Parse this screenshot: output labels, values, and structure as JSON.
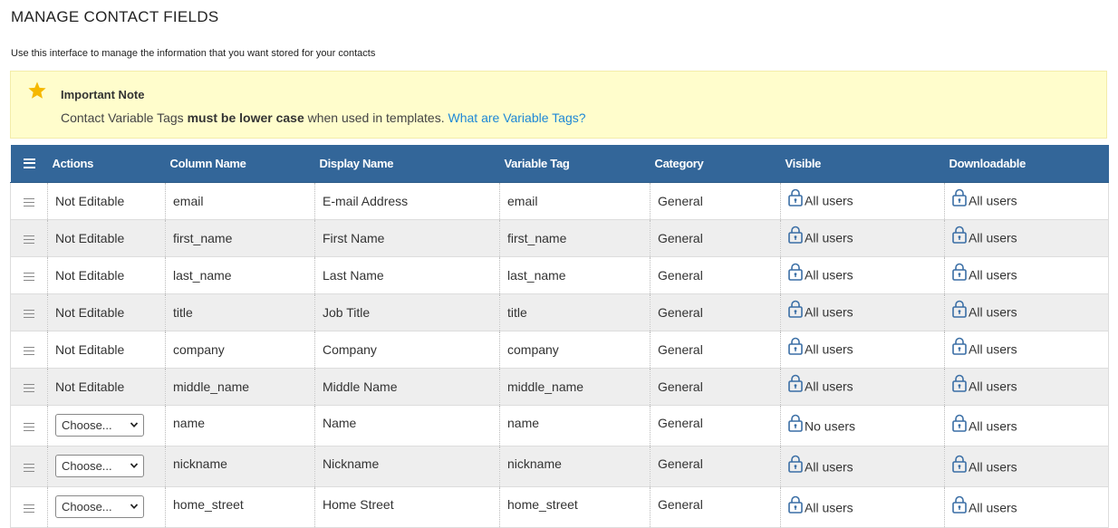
{
  "page": {
    "title": "MANAGE CONTACT FIELDS",
    "subtitle": "Use this interface to manage the information that you want stored for your contacts"
  },
  "note": {
    "icon": "star-icon",
    "title": "Important Note",
    "text_before": "Contact Variable Tags ",
    "text_bold": "must be lower case",
    "text_after": " when used in templates. ",
    "link": "What are Variable Tags?"
  },
  "colors": {
    "header_bg": "#336699",
    "note_bg": "#fffdcc",
    "link": "#1e88d6",
    "star": "#f5b800",
    "lock": "#3a6ea5"
  },
  "table": {
    "headers": {
      "menu_icon": "menu-icon",
      "actions": "Actions",
      "column_name": "Column Name",
      "display_name": "Display Name",
      "variable_tag": "Variable Tag",
      "category": "Category",
      "visible": "Visible",
      "downloadable": "Downloadable"
    },
    "rows": [
      {
        "actions": "Not Editable",
        "column_name": "email",
        "display_name": "E-mail Address",
        "variable_tag": "email",
        "category": "General",
        "visible": "All users",
        "downloadable": "All users"
      },
      {
        "actions": "Not Editable",
        "column_name": "first_name",
        "display_name": "First Name",
        "variable_tag": "first_name",
        "category": "General",
        "visible": "All users",
        "downloadable": "All users"
      },
      {
        "actions": "Not Editable",
        "column_name": "last_name",
        "display_name": "Last Name",
        "variable_tag": "last_name",
        "category": "General",
        "visible": "All users",
        "downloadable": "All users"
      },
      {
        "actions": "Not Editable",
        "column_name": "title",
        "display_name": "Job Title",
        "variable_tag": "title",
        "category": "General",
        "visible": "All users",
        "downloadable": "All users"
      },
      {
        "actions": "Not Editable",
        "column_name": "company",
        "display_name": "Company",
        "variable_tag": "company",
        "category": "General",
        "visible": "All users",
        "downloadable": "All users"
      },
      {
        "actions": "Not Editable",
        "column_name": "middle_name",
        "display_name": "Middle Name",
        "variable_tag": "middle_name",
        "category": "General",
        "visible": "All users",
        "downloadable": "All users"
      },
      {
        "actions": "Choose...",
        "column_name": "name",
        "display_name": "Name",
        "variable_tag": "name",
        "category": "General",
        "visible": "No users",
        "downloadable": "All users"
      },
      {
        "actions": "Choose...",
        "column_name": "nickname",
        "display_name": "Nickname",
        "variable_tag": "nickname",
        "category": "General",
        "visible": "All users",
        "downloadable": "All users"
      },
      {
        "actions": "Choose...",
        "column_name": "home_street",
        "display_name": "Home Street",
        "variable_tag": "home_street",
        "category": "General",
        "visible": "All users",
        "downloadable": "All users"
      }
    ]
  }
}
